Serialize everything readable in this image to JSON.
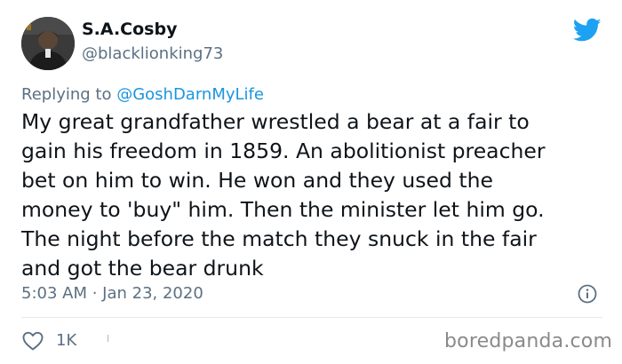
{
  "user": {
    "display_name": "S.A.Cosby",
    "handle": "@blacklionking73"
  },
  "reply": {
    "prefix": "Replying to ",
    "mention": "@GoshDarnMyLife"
  },
  "tweet": {
    "lines": [
      "My great grandfather wrestled a bear at a fair to",
      "gain his freedom in 1859. An abolitionist preacher",
      "bet on him to win. He won and they used the",
      "money to 'buy\" him. Then the minister let him go.",
      "The night before the match they snuck in the fair",
      "and got the bear drunk"
    ],
    "timestamp": "5:03 AM · Jan 23, 2020"
  },
  "actions": {
    "like_count": "1K"
  },
  "watermark": "boredpanda.com",
  "colors": {
    "twitter_blue": "#1da1f2",
    "mention_blue": "#1b95e0",
    "secondary_text": "#5b7083",
    "primary_text": "#0f1419"
  },
  "icons": {
    "brand": "twitter-bird-icon",
    "info": "info-icon",
    "like": "heart-icon"
  }
}
